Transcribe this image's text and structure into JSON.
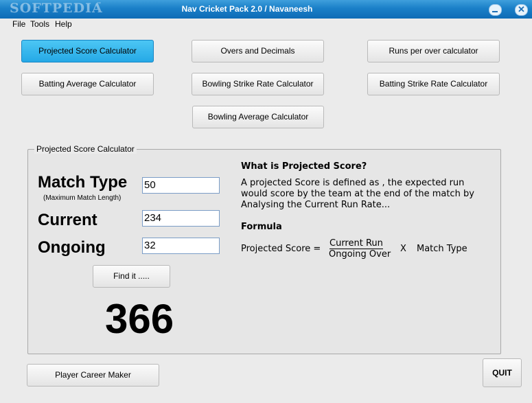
{
  "window": {
    "title": "Nav Cricket Pack 2.0   /  Navaneesh",
    "watermark": "SOFTPEDIA",
    "watermark_tm": "™",
    "close_glyph": "✕"
  },
  "menu": {
    "file": "File",
    "tools": "Tools",
    "help": "Help"
  },
  "calculators": {
    "projected_score": "Projected Score Calculator",
    "overs_decimals": "Overs and Decimals",
    "runs_per_over": "Runs per over calculator",
    "batting_average": "Batting Average Calculator",
    "bowling_strike_rate": "Bowling Strike Rate Calculator",
    "batting_strike_rate": "Batting Strike Rate Calculator",
    "bowling_average": "Bowling Average Calculator"
  },
  "panel": {
    "title": "Projected Score Calculator",
    "match_type_label": "Match Type",
    "match_type_hint": "(Maximum Match Length)",
    "match_type_value": "50",
    "current_label": "Current",
    "current_value": "234",
    "ongoing_label": "Ongoing",
    "ongoing_value": "32",
    "find_button": "Find it .....",
    "result": "366"
  },
  "info": {
    "heading": "What is Projected Score?",
    "line1": "A projected Score is defined as , the expected run",
    "line2": "would score by the team at the end of the match by",
    "line3": "Analysing the Current Run Rate...",
    "formula_heading": "Formula",
    "formula_lhs": "Projected Score =",
    "formula_num": "Current Run",
    "formula_den": "Ongoing Over",
    "formula_times": "X",
    "formula_rhs": "Match Type"
  },
  "footer": {
    "career_button": "Player Career Maker",
    "quit_button": "QUIT"
  },
  "colors": {
    "titlebar": "#1a7fc8",
    "active_button": "#25a9e6"
  }
}
